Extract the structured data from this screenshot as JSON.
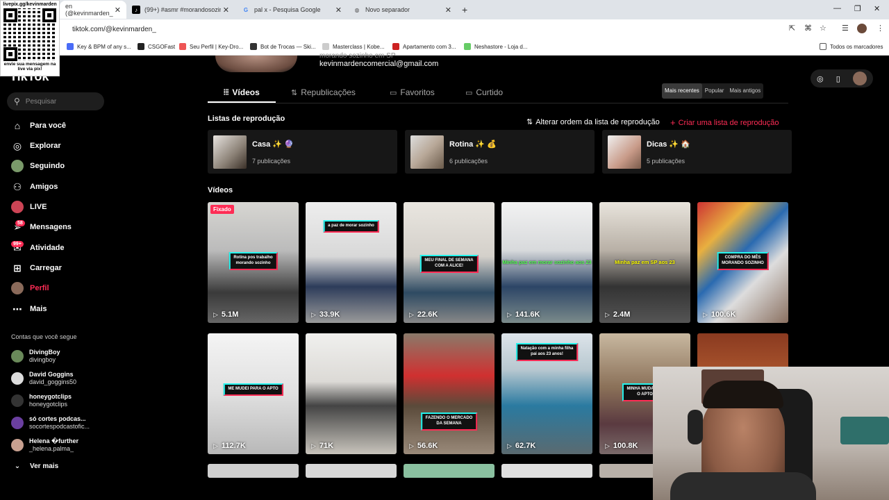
{
  "browser": {
    "tabs": [
      {
        "title": "en (@kevinmarden_",
        "active": true
      },
      {
        "title": "(99+) #asmr #morandosozinho",
        "active": false
      },
      {
        "title": "pal x - Pesquisa Google",
        "active": false
      },
      {
        "title": "Novo separador",
        "active": false
      }
    ],
    "url": "tiktok.com/@kevinmarden_",
    "bookmarks": [
      {
        "label": "Key & BPM of any s...",
        "color": "#4a6cf7"
      },
      {
        "label": "CSGOFast",
        "color": "#222"
      },
      {
        "label": "Seu Perfil | Key-Dro...",
        "color": "#e55"
      },
      {
        "label": "Bot de Trocas — Ski...",
        "color": "#333"
      },
      {
        "label": "Masterclass | Kobe...",
        "color": "#ccc"
      },
      {
        "label": "Apartamento com 3...",
        "color": "#c22"
      },
      {
        "label": "Neshastore - Loja d...",
        "color": "#6c6"
      }
    ],
    "all_bookmarks": "Todos os marcadores"
  },
  "overlay": {
    "qr_top": "livepix.gg/kevinmarden",
    "qr_bottom": "envie sua mensagem na live via pix!"
  },
  "sidebar": {
    "logo": "TikTok",
    "search_placeholder": "Pesquisar",
    "items": [
      {
        "label": "Para você",
        "icon": "home-icon"
      },
      {
        "label": "Explorar",
        "icon": "compass-icon"
      },
      {
        "label": "Seguindo",
        "icon": "following-icon"
      },
      {
        "label": "Amigos",
        "icon": "friends-icon"
      },
      {
        "label": "LIVE",
        "icon": "live-icon"
      },
      {
        "label": "Mensagens",
        "icon": "message-icon",
        "badge": "58"
      },
      {
        "label": "Atividade",
        "icon": "activity-icon",
        "badge": "99+"
      },
      {
        "label": "Carregar",
        "icon": "upload-icon"
      },
      {
        "label": "Perfil",
        "icon": "profile-icon"
      },
      {
        "label": "Mais",
        "icon": "more-icon"
      }
    ],
    "following_header": "Contas que você segue",
    "accounts": [
      {
        "name": "DivingBoy",
        "handle": "divingboy",
        "color": "#6a8a5a"
      },
      {
        "name": "David Goggins",
        "handle": "david_goggins50",
        "color": "#ddd"
      },
      {
        "name": "honeygotclips",
        "handle": "honeygotclips",
        "color": "#333"
      },
      {
        "name": "só cortes podcas...",
        "handle": "socortespodcastofic...",
        "color": "#6a3fa0"
      },
      {
        "name": "Helena �further",
        "handle": "_helena.palma_",
        "color": "#c8a090"
      }
    ],
    "see_more": "Ver mais"
  },
  "profile": {
    "cut_text": "morando sozinho em SP",
    "email": "kevinmardencomercial@gmail.com",
    "tabs": [
      "Vídeos",
      "Republicações",
      "Favoritos",
      "Curtido"
    ],
    "sort": [
      "Mais recentes",
      "Popular",
      "Mais antigos"
    ],
    "playlists_title": "Listas de reprodução",
    "reorder_label": "Alterar ordem da lista de reprodução",
    "create_label": "Criar uma lista de reprodução",
    "playlists": [
      {
        "name": "Casa ✨ 🔮",
        "count": "7 publicações"
      },
      {
        "name": "Rotina ✨ 💰",
        "count": "6 publicações"
      },
      {
        "name": "Dicas ✨ 🏠",
        "count": "5 publicações"
      }
    ],
    "videos_title": "Vídeos",
    "pinned_label": "Fixado",
    "videos_row1": [
      {
        "views": "5.1M",
        "caption": "Rotina pos trabalho\nmorando sozinho"
      },
      {
        "views": "33.9K",
        "caption": "a paz de morar sozinho"
      },
      {
        "views": "22.6K",
        "caption": "MEU FINAL DE SEMANA\nCOM A ALICE!"
      },
      {
        "views": "141.6K",
        "caption": "Minha paz em morar sozinho aos 23"
      },
      {
        "views": "2.4M",
        "caption": "Minha paz em SP aos 23"
      },
      {
        "views": "100.6K",
        "caption": "COMPRA DO MÊS\nMORANDO SOZINHO"
      }
    ],
    "videos_row2": [
      {
        "views": "112.7K",
        "caption": "ME MUDEI PARA O APTO"
      },
      {
        "views": "71K",
        "caption": ""
      },
      {
        "views": "56.6K",
        "caption": "FAZENDO O MERCADO\nDA SEMANA"
      },
      {
        "views": "62.7K",
        "caption": "Natação com a minha filha\npai aos 23 anos!"
      },
      {
        "views": "100.8K",
        "caption": "MINHA MUDANÇA\nO APTO"
      },
      {
        "views": "",
        "caption": ""
      }
    ]
  }
}
